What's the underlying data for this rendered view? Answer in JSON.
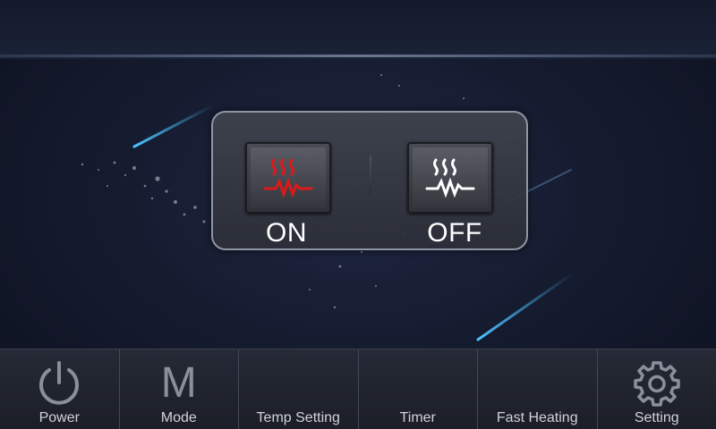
{
  "heater": {
    "on_label": "ON",
    "off_label": "OFF",
    "on_icon": "heater-red-icon",
    "off_icon": "heater-white-icon",
    "on_color": "#e01818",
    "off_color": "#ffffff"
  },
  "nav": {
    "items": [
      {
        "label": "Power",
        "icon": "power-icon"
      },
      {
        "label": "Mode",
        "icon": "mode-m-icon",
        "glyph": "M"
      },
      {
        "label": "Temp Setting",
        "icon": ""
      },
      {
        "label": "Timer",
        "icon": ""
      },
      {
        "label": "Fast Heating",
        "icon": ""
      },
      {
        "label": "Setting",
        "icon": "gear-icon"
      }
    ]
  },
  "colors": {
    "background": "#161c30",
    "panel_border": "#8f95a2",
    "nav_icon": "#8a8f9c",
    "streak": "#3fb6ff"
  }
}
